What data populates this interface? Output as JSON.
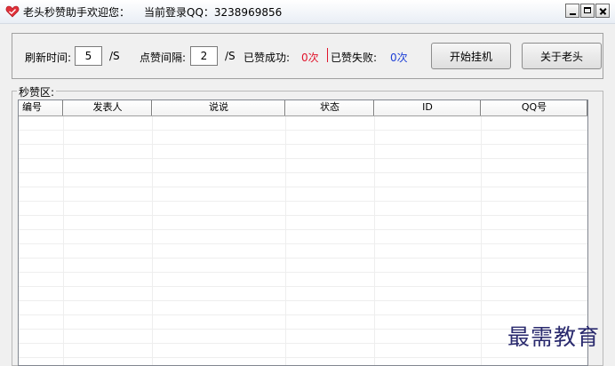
{
  "window": {
    "title": "老头秒赞助手欢迎您：",
    "login_text": "当前登录QQ：3238969856",
    "app_icon": "heart-icon"
  },
  "settings": {
    "refresh_label": "刷新时间:",
    "refresh_value": "5",
    "refresh_unit": "/S",
    "interval_label": "点赞间隔:",
    "interval_value": "2",
    "interval_unit": "/S",
    "success_label": "已赞成功:",
    "success_value": "0次",
    "fail_label": "已赞失败:",
    "fail_value": "0次",
    "start_button": "开始挂机",
    "about_button": "关于老头"
  },
  "group": {
    "title": "秒赞区:",
    "columns": [
      "编号",
      "发表人",
      "说说",
      "状态",
      "ID",
      "QQ号"
    ],
    "rows": []
  },
  "watermark": "最需教育",
  "colors": {
    "success": "#e0142b",
    "fail": "#1d3fd6"
  }
}
